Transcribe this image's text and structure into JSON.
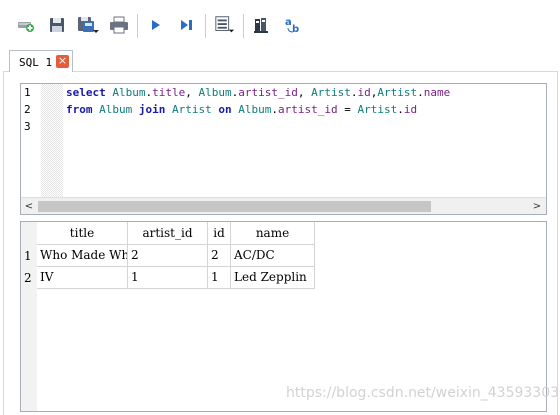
{
  "toolbar": {
    "buttons": [
      {
        "name": "new-connection-icon"
      },
      {
        "name": "save-icon"
      },
      {
        "name": "save-as-icon"
      },
      {
        "name": "print-icon"
      },
      {
        "name": "run-icon"
      },
      {
        "name": "run-step-icon"
      },
      {
        "name": "explain-icon"
      },
      {
        "name": "query-builder-icon"
      },
      {
        "name": "beautify-icon"
      }
    ]
  },
  "tab": {
    "label": "SQL 1",
    "close_glyph": "×"
  },
  "editor": {
    "line_numbers": [
      "1",
      "2",
      "3"
    ],
    "line1": {
      "t1": "select",
      "t2": " ",
      "t3": "Album",
      "t4": ".",
      "t5": "title",
      "t6": ", ",
      "t7": "Album",
      "t8": ".",
      "t9": "artist_id",
      "t10": ", ",
      "t11": "Artist",
      "t12": ".",
      "t13": "id",
      "t14": ",",
      "t15": "Artist",
      "t16": ".",
      "t17": "name"
    },
    "line2": {
      "t1": "from",
      "t2": " ",
      "t3": "Album",
      "t4": " ",
      "t5": "join",
      "t6": " ",
      "t7": "Artist",
      "t8": " ",
      "t9": "on",
      "t10": " ",
      "t11": "Album",
      "t12": ".",
      "t13": "artist_id",
      "t14": " = ",
      "t15": "Artist",
      "t16": ".",
      "t17": "id"
    },
    "scroll_left": "<",
    "scroll_right": ">"
  },
  "result": {
    "columns": [
      "title",
      "artist_id",
      "id",
      "name"
    ],
    "rows": [
      {
        "rownum": "1",
        "cells": [
          "Who Made Who",
          "2",
          "2",
          "AC/DC"
        ]
      },
      {
        "rownum": "2",
        "cells": [
          "IV",
          "1",
          "1",
          "Led Zepplin"
        ]
      }
    ]
  },
  "watermark": "https://blog.csdn.net/weixin_43593303"
}
